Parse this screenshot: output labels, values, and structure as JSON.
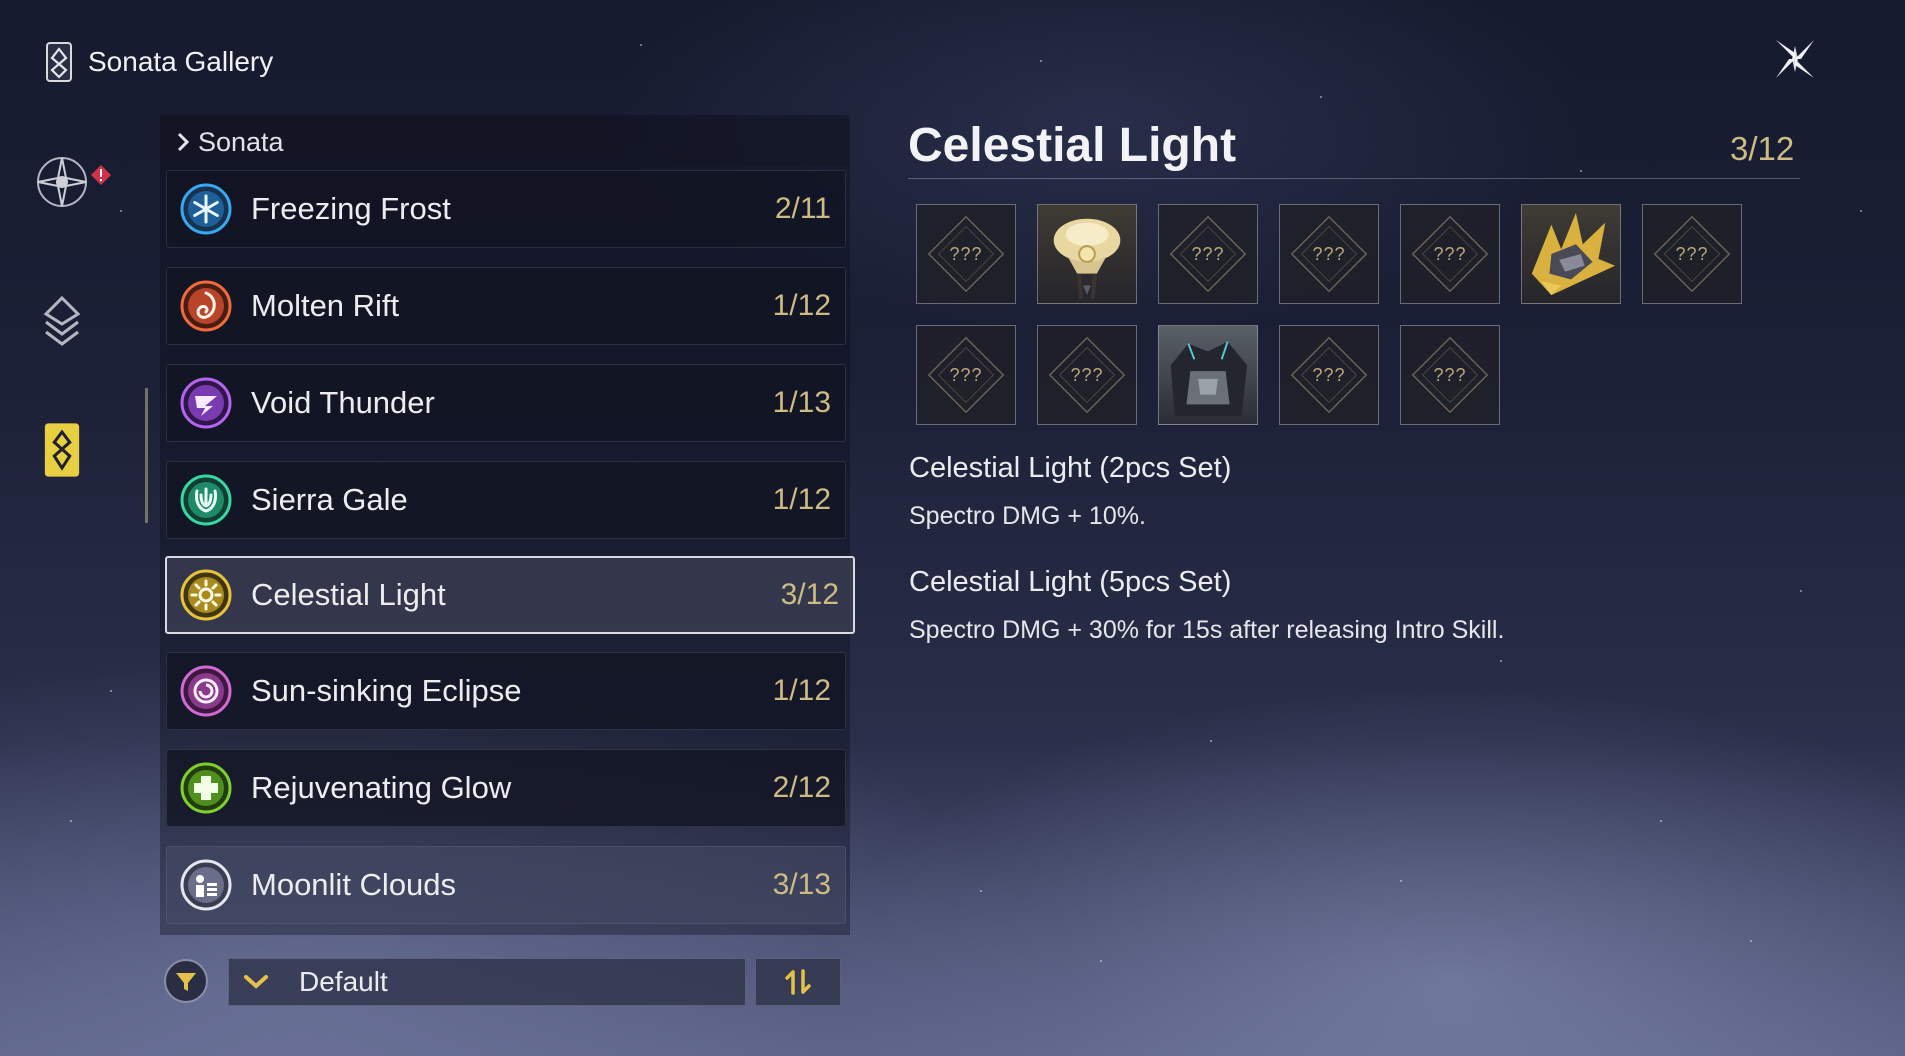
{
  "header": {
    "title": "Sonata Gallery"
  },
  "list": {
    "category": "Sonata",
    "items": [
      {
        "name": "Freezing Frost",
        "count": "2/11",
        "icon": "snowflake-icon",
        "color": "#3aa7f0"
      },
      {
        "name": "Molten Rift",
        "count": "1/12",
        "icon": "flame-swirl-icon",
        "color": "#ef6a3d"
      },
      {
        "name": "Void Thunder",
        "count": "1/13",
        "icon": "thunder-swirl-icon",
        "color": "#b564f0"
      },
      {
        "name": "Sierra Gale",
        "count": "1/12",
        "icon": "wind-icon",
        "color": "#38d6a0"
      },
      {
        "name": "Celestial Light",
        "count": "3/12",
        "icon": "sun-icon",
        "color": "#e8c23a",
        "selected": true
      },
      {
        "name": "Sun-sinking Eclipse",
        "count": "1/12",
        "icon": "eclipse-icon",
        "color": "#d06ad0"
      },
      {
        "name": "Rejuvenating Glow",
        "count": "2/12",
        "icon": "heal-plus-icon",
        "color": "#7ed030"
      },
      {
        "name": "Moonlit Clouds",
        "count": "3/13",
        "icon": "moonlit-clouds-icon",
        "color": "#e6e6ee"
      }
    ]
  },
  "sort": {
    "label": "Default"
  },
  "detail": {
    "title": "Celestial Light",
    "count": "3/12",
    "echoes": [
      {
        "label": "???",
        "owned": false
      },
      {
        "label": "",
        "owned": true
      },
      {
        "label": "???",
        "owned": false
      },
      {
        "label": "???",
        "owned": false
      },
      {
        "label": "???",
        "owned": false
      },
      {
        "label": "",
        "owned": true
      },
      {
        "label": "???",
        "owned": false
      },
      {
        "label": "???",
        "owned": false
      },
      {
        "label": "???",
        "owned": false
      },
      {
        "label": "",
        "owned": true
      },
      {
        "label": "???",
        "owned": false
      },
      {
        "label": "???",
        "owned": false
      }
    ],
    "set2": {
      "title": "Celestial Light (2pcs Set)",
      "desc": "Spectro DMG + 10%."
    },
    "set5": {
      "title": "Celestial Light (5pcs Set)",
      "desc": "Spectro DMG + 30% for 15s after releasing Intro Skill."
    }
  },
  "colors": {
    "accent": "#cdbb84",
    "alert": "#d0324a"
  }
}
